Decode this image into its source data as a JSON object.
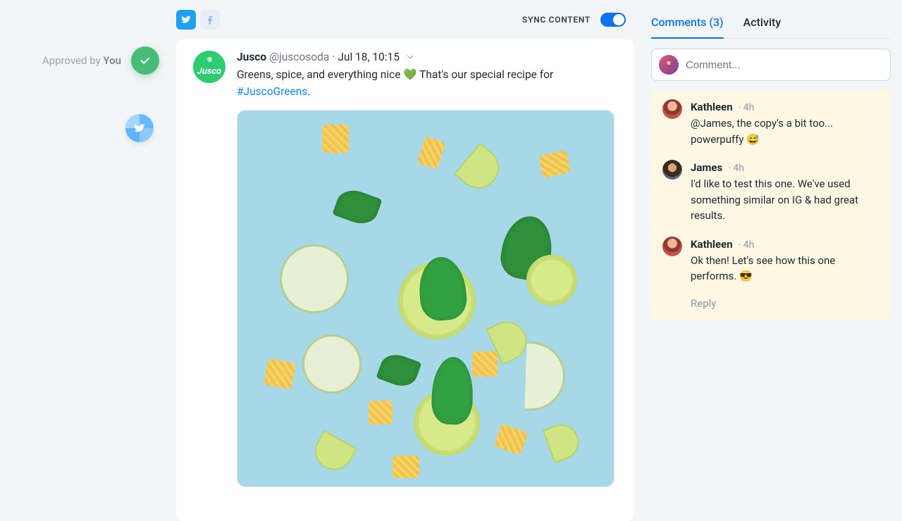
{
  "left_rail": {
    "approved_prefix": "Approved by ",
    "approved_by": "You"
  },
  "topbar": {
    "sync_label": "SYNC CONTENT"
  },
  "post": {
    "brand_short": "Jusco",
    "author": "Jusco",
    "handle": "@juscosoda",
    "date": "Jul 18, 10:15",
    "text_before": "Greens, spice, and everything nice ",
    "text_after": " That's our special recipe for ",
    "hashtag": "#JuscoGreens",
    "tail": "."
  },
  "right": {
    "tab_comments": "Comments (3)",
    "tab_activity": "Activity",
    "input_placeholder": "Comment...",
    "reply": "Reply",
    "comments": [
      {
        "name": "Kathleen",
        "time": "4h",
        "text": "@James, the copy's a bit too... powerpuffy 😅"
      },
      {
        "name": "James",
        "time": "4h",
        "text": "I'd like to test this one. We've used something similar on IG & had great results."
      },
      {
        "name": "Kathleen",
        "time": "4h",
        "text": "Ok then! Let's see how this one performs. 😎"
      }
    ]
  }
}
